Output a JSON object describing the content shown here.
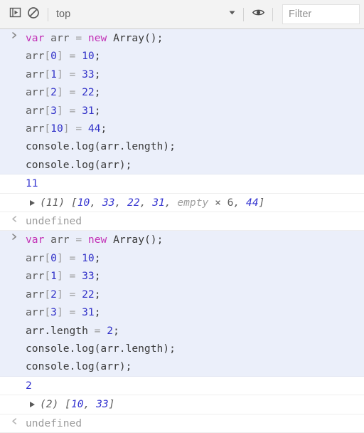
{
  "toolbar": {
    "sidebar_toggle_icon": "console-sidebar-icon",
    "clear_icon": "clear-console-icon",
    "context_selected": "top",
    "dropdown_icon": "chevron-down-icon",
    "eye_icon": "eye-icon",
    "filter_placeholder": "Filter",
    "filter_value": "",
    "background": "#f3f3f3"
  },
  "console": {
    "prompt_glyph": ">",
    "response_glyph": "‹",
    "disclosure_glyph": "▶",
    "entries": [
      {
        "type": "input",
        "lines": [
          [
            {
              "t": "var",
              "c": "kw"
            },
            {
              "t": " ",
              "c": "plain"
            },
            {
              "t": "arr",
              "c": "ident"
            },
            {
              "t": " ",
              "c": "plain"
            },
            {
              "t": "=",
              "c": "punc"
            },
            {
              "t": " ",
              "c": "plain"
            },
            {
              "t": "new",
              "c": "kw"
            },
            {
              "t": " ",
              "c": "plain"
            },
            {
              "t": "Array",
              "c": "fn"
            },
            {
              "t": "();",
              "c": "plain"
            }
          ],
          [
            {
              "t": "arr",
              "c": "ident"
            },
            {
              "t": "[",
              "c": "punc"
            },
            {
              "t": "0",
              "c": "num"
            },
            {
              "t": "]",
              "c": "punc"
            },
            {
              "t": " ",
              "c": "plain"
            },
            {
              "t": "=",
              "c": "punc"
            },
            {
              "t": " ",
              "c": "plain"
            },
            {
              "t": "10",
              "c": "num"
            },
            {
              "t": ";",
              "c": "plain"
            }
          ],
          [
            {
              "t": "arr",
              "c": "ident"
            },
            {
              "t": "[",
              "c": "punc"
            },
            {
              "t": "1",
              "c": "num"
            },
            {
              "t": "]",
              "c": "punc"
            },
            {
              "t": " ",
              "c": "plain"
            },
            {
              "t": "=",
              "c": "punc"
            },
            {
              "t": " ",
              "c": "plain"
            },
            {
              "t": "33",
              "c": "num"
            },
            {
              "t": ";",
              "c": "plain"
            }
          ],
          [
            {
              "t": "arr",
              "c": "ident"
            },
            {
              "t": "[",
              "c": "punc"
            },
            {
              "t": "2",
              "c": "num"
            },
            {
              "t": "]",
              "c": "punc"
            },
            {
              "t": " ",
              "c": "plain"
            },
            {
              "t": "=",
              "c": "punc"
            },
            {
              "t": " ",
              "c": "plain"
            },
            {
              "t": "22",
              "c": "num"
            },
            {
              "t": ";",
              "c": "plain"
            }
          ],
          [
            {
              "t": "arr",
              "c": "ident"
            },
            {
              "t": "[",
              "c": "punc"
            },
            {
              "t": "3",
              "c": "num"
            },
            {
              "t": "]",
              "c": "punc"
            },
            {
              "t": " ",
              "c": "plain"
            },
            {
              "t": "=",
              "c": "punc"
            },
            {
              "t": " ",
              "c": "plain"
            },
            {
              "t": "31",
              "c": "num"
            },
            {
              "t": ";",
              "c": "plain"
            }
          ],
          [
            {
              "t": "arr",
              "c": "ident"
            },
            {
              "t": "[",
              "c": "punc"
            },
            {
              "t": "10",
              "c": "num"
            },
            {
              "t": "]",
              "c": "punc"
            },
            {
              "t": " ",
              "c": "plain"
            },
            {
              "t": "=",
              "c": "punc"
            },
            {
              "t": " ",
              "c": "plain"
            },
            {
              "t": "44",
              "c": "num"
            },
            {
              "t": ";",
              "c": "plain"
            }
          ],
          [
            {
              "t": "console.log(arr.length);",
              "c": "plain"
            }
          ],
          [
            {
              "t": "console.log(arr);",
              "c": "plain"
            }
          ]
        ]
      },
      {
        "type": "result",
        "value": "11"
      },
      {
        "type": "expand",
        "length_label": "(11)",
        "open_bracket": "[",
        "items": [
          "10",
          "33",
          "22",
          "31"
        ],
        "empty_label": "empty",
        "empty_times": "×",
        "empty_count": "6",
        "tail_item": "44",
        "close_bracket": "]"
      },
      {
        "type": "undefined",
        "value": "undefined"
      },
      {
        "type": "input",
        "lines": [
          [
            {
              "t": "var",
              "c": "kw"
            },
            {
              "t": " ",
              "c": "plain"
            },
            {
              "t": "arr",
              "c": "ident"
            },
            {
              "t": " ",
              "c": "plain"
            },
            {
              "t": "=",
              "c": "punc"
            },
            {
              "t": " ",
              "c": "plain"
            },
            {
              "t": "new",
              "c": "kw"
            },
            {
              "t": " ",
              "c": "plain"
            },
            {
              "t": "Array",
              "c": "fn"
            },
            {
              "t": "();",
              "c": "plain"
            }
          ],
          [
            {
              "t": "arr",
              "c": "ident"
            },
            {
              "t": "[",
              "c": "punc"
            },
            {
              "t": "0",
              "c": "num"
            },
            {
              "t": "]",
              "c": "punc"
            },
            {
              "t": " ",
              "c": "plain"
            },
            {
              "t": "=",
              "c": "punc"
            },
            {
              "t": " ",
              "c": "plain"
            },
            {
              "t": "10",
              "c": "num"
            },
            {
              "t": ";",
              "c": "plain"
            }
          ],
          [
            {
              "t": "arr",
              "c": "ident"
            },
            {
              "t": "[",
              "c": "punc"
            },
            {
              "t": "1",
              "c": "num"
            },
            {
              "t": "]",
              "c": "punc"
            },
            {
              "t": " ",
              "c": "plain"
            },
            {
              "t": "=",
              "c": "punc"
            },
            {
              "t": " ",
              "c": "plain"
            },
            {
              "t": "33",
              "c": "num"
            },
            {
              "t": ";",
              "c": "plain"
            }
          ],
          [
            {
              "t": "arr",
              "c": "ident"
            },
            {
              "t": "[",
              "c": "punc"
            },
            {
              "t": "2",
              "c": "num"
            },
            {
              "t": "]",
              "c": "punc"
            },
            {
              "t": " ",
              "c": "plain"
            },
            {
              "t": "=",
              "c": "punc"
            },
            {
              "t": " ",
              "c": "plain"
            },
            {
              "t": "22",
              "c": "num"
            },
            {
              "t": ";",
              "c": "plain"
            }
          ],
          [
            {
              "t": "arr",
              "c": "ident"
            },
            {
              "t": "[",
              "c": "punc"
            },
            {
              "t": "3",
              "c": "num"
            },
            {
              "t": "]",
              "c": "punc"
            },
            {
              "t": " ",
              "c": "plain"
            },
            {
              "t": "=",
              "c": "punc"
            },
            {
              "t": " ",
              "c": "plain"
            },
            {
              "t": "31",
              "c": "num"
            },
            {
              "t": ";",
              "c": "plain"
            }
          ],
          [
            {
              "t": "arr.length",
              "c": "plain"
            },
            {
              "t": " ",
              "c": "plain"
            },
            {
              "t": "=",
              "c": "punc"
            },
            {
              "t": " ",
              "c": "plain"
            },
            {
              "t": "2",
              "c": "num"
            },
            {
              "t": ";",
              "c": "plain"
            }
          ],
          [
            {
              "t": "console.log(arr.length);",
              "c": "plain"
            }
          ],
          [
            {
              "t": "console.log(arr);",
              "c": "plain"
            }
          ]
        ]
      },
      {
        "type": "result",
        "value": "2"
      },
      {
        "type": "expand",
        "length_label": "(2)",
        "open_bracket": "[",
        "items": [
          "10",
          "33"
        ],
        "close_bracket": "]"
      },
      {
        "type": "undefined",
        "value": "undefined"
      }
    ]
  }
}
